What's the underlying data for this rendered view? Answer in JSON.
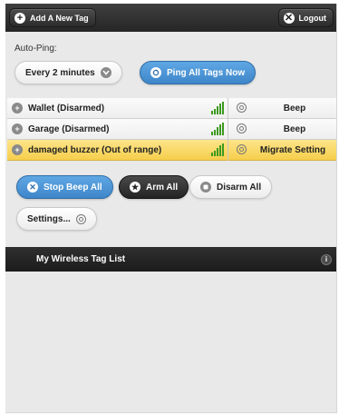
{
  "header": {
    "add_label": "Add A New Tag",
    "add_icon": "plus-icon",
    "logout_label": "Logout",
    "logout_icon": "close-icon"
  },
  "autoping": {
    "label": "Auto-Ping:",
    "interval_value": "Every 2 minutes",
    "ping_all_label": "Ping All Tags Now"
  },
  "tags": [
    {
      "name": "Wallet (Disarmed)",
      "action": "Beep",
      "selected": false
    },
    {
      "name": "Garage (Disarmed)",
      "action": "Beep",
      "selected": false
    },
    {
      "name": "damaged buzzer (Out of range)",
      "action": "Migrate Setting",
      "selected": true
    }
  ],
  "actions": {
    "stop_beep_label": "Stop Beep All",
    "arm_all_label": "Arm All",
    "disarm_all_label": "Disarm All",
    "settings_label": "Settings..."
  },
  "list": {
    "title": "My Wireless Tag List",
    "info_icon": "info-icon"
  },
  "colors": {
    "accent_blue": "#3e86c9",
    "header_dark": "#262626",
    "selected_row": "#f6cf4c",
    "signal_green": "#3c9a1e"
  }
}
